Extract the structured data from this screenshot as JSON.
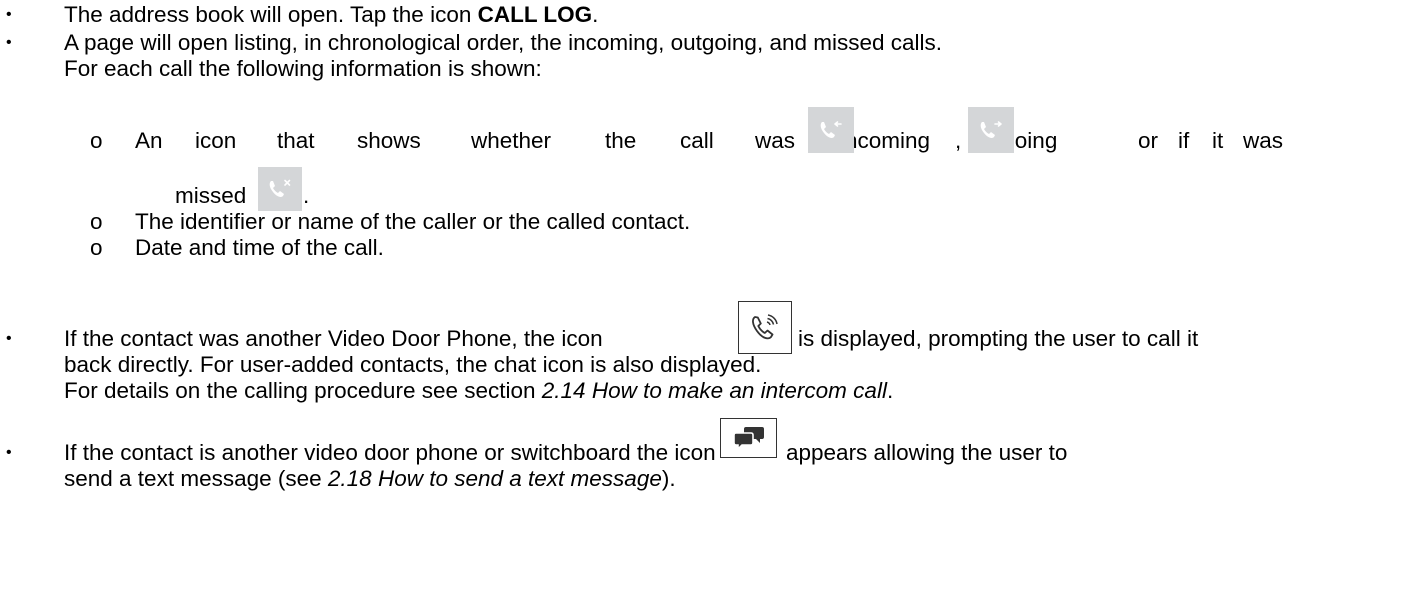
{
  "b1": {
    "pre": "The address book will open. Tap the icon ",
    "bold": "CALL LOG",
    "post": "."
  },
  "b2": {
    "line1": "A page will open listing, in chronological order, the incoming, outgoing, and missed calls.",
    "line2": "For each call the following information is shown:"
  },
  "s1": {
    "w1": "An",
    "w2": "icon",
    "w3": "that",
    "w4": "shows",
    "w5": "whether",
    "w6": "the",
    "w7": "call",
    "w8": "was",
    "w9": "incoming",
    "comma": ",",
    "outgoing": "outgoing",
    "or": "or",
    "if": "if",
    "it": "it",
    "was": "was",
    "missed": "missed",
    "dot": "."
  },
  "s2": "The identifier or name of the caller or the called contact.",
  "s3": "Date and time of the call.",
  "b3": {
    "l1_pre": "If the contact was another Video Door Phone, the icon",
    "l1_post": "is displayed, prompting the user to call it",
    "l2": "back directly. For user-added contacts, the chat icon is also displayed.",
    "l3_pre": "For details on the calling procedure see section ",
    "l3_italic": "2.14 How to make an intercom call",
    "l3_post": "."
  },
  "b4": {
    "l1_pre": "If the contact is another video door phone or switchboard the icon",
    "l1_post": "appears allowing the user to",
    "l2_pre": "send a text message (see ",
    "l2_italic": "2.18 How to send a text message",
    "l2_post": ")."
  },
  "symbols": {
    "bullet": "•",
    "sub_bullet": "o"
  },
  "colors": {
    "icon_bg": "#d4d6d8",
    "icon_fg": "#ffffff",
    "frame": "#333333"
  },
  "icons": [
    "call-incoming-icon",
    "call-outgoing-icon",
    "call-missed-icon",
    "video-door-phone-call-icon",
    "chat-icon"
  ]
}
